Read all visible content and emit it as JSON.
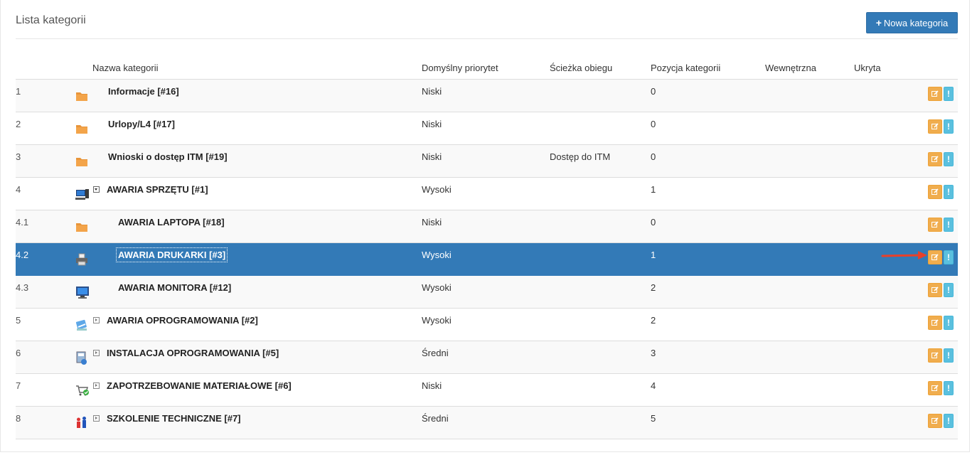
{
  "panel": {
    "title": "Lista kategorii",
    "new_button_label": "Nowa kategoria"
  },
  "table": {
    "headers": {
      "number": "",
      "icon": "",
      "name": "Nazwa kategorii",
      "priority": "Domyślny priorytet",
      "workflow": "Ścieżka obiegu",
      "position": "Pozycja kategorii",
      "internal": "Wewnętrzna",
      "hidden": "Ukryta"
    },
    "rows": [
      {
        "num": "1",
        "icon": "folder-icon",
        "name": "Informacje [#16]",
        "priority": "Niski",
        "workflow": "",
        "position": "0",
        "level": 0,
        "expander": "none"
      },
      {
        "num": "2",
        "icon": "folder-icon",
        "name": "Urlopy/L4 [#17]",
        "priority": "Niski",
        "workflow": "",
        "position": "0",
        "level": 0,
        "expander": "none"
      },
      {
        "num": "3",
        "icon": "folder-icon",
        "name": "Wnioski o dostęp ITM [#19]",
        "priority": "Niski",
        "workflow": "Dostęp do ITM",
        "position": "0",
        "level": 0,
        "expander": "none"
      },
      {
        "num": "4",
        "icon": "computer-icon",
        "name": "AWARIA SPRZĘTU [#1]",
        "priority": "Wysoki",
        "workflow": "",
        "position": "1",
        "level": 0,
        "expander": "open"
      },
      {
        "num": "4.1",
        "icon": "folder-icon",
        "name": "AWARIA LAPTOPA [#18]",
        "priority": "Niski",
        "workflow": "",
        "position": "0",
        "level": 1,
        "expander": "none"
      },
      {
        "num": "4.2",
        "icon": "printer-icon",
        "name": "AWARIA DRUKARKI [#3]",
        "priority": "Wysoki",
        "workflow": "",
        "position": "1",
        "level": 1,
        "expander": "none",
        "selected": true
      },
      {
        "num": "4.3",
        "icon": "monitor-icon",
        "name": "AWARIA MONITORA [#12]",
        "priority": "Wysoki",
        "workflow": "",
        "position": "2",
        "level": 1,
        "expander": "none"
      },
      {
        "num": "5",
        "icon": "software-icon",
        "name": "AWARIA OPROGRAMOWANIA [#2]",
        "priority": "Wysoki",
        "workflow": "",
        "position": "2",
        "level": 0,
        "expander": "closed"
      },
      {
        "num": "6",
        "icon": "install-icon",
        "name": "INSTALACJA OPROGRAMOWANIA [#5]",
        "priority": "Średni",
        "workflow": "",
        "position": "3",
        "level": 0,
        "expander": "closed"
      },
      {
        "num": "7",
        "icon": "cart-icon",
        "name": "ZAPOTRZEBOWANIE MATERIAŁOWE [#6]",
        "priority": "Niski",
        "workflow": "",
        "position": "4",
        "level": 0,
        "expander": "closed"
      },
      {
        "num": "8",
        "icon": "training-icon",
        "name": "SZKOLENIE TECHNICZNE [#7]",
        "priority": "Średni",
        "workflow": "",
        "position": "5",
        "level": 0,
        "expander": "closed"
      }
    ]
  },
  "colors": {
    "primary": "#337ab7",
    "edit": "#f0ad4e",
    "info": "#5bc0de",
    "arrow": "#e8402a"
  }
}
